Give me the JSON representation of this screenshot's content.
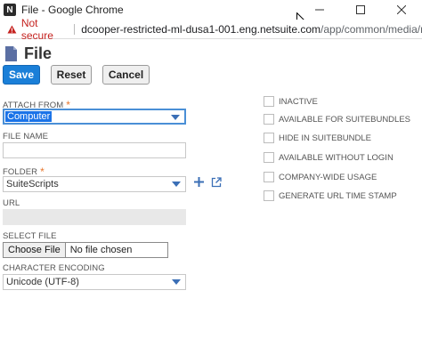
{
  "window": {
    "title": "File - Google Chrome",
    "app_icon_letter": "N"
  },
  "addressbar": {
    "security_label": "Not secure",
    "url_host": "dcooper-restricted-ml-dusa1-001.eng.netsuite.com",
    "url_path": "/app/common/media/media..."
  },
  "page": {
    "title": "File"
  },
  "toolbar": {
    "save_label": "Save",
    "reset_label": "Reset",
    "cancel_label": "Cancel"
  },
  "form": {
    "attach_from": {
      "label": "ATTACH FROM",
      "value": "Computer"
    },
    "file_name": {
      "label": "FILE NAME",
      "value": ""
    },
    "folder": {
      "label": "FOLDER",
      "value": "SuiteScripts"
    },
    "url": {
      "label": "URL",
      "value": ""
    },
    "select_file": {
      "label": "SELECT FILE",
      "button_label": "Choose File",
      "status": "No file chosen"
    },
    "character_encoding": {
      "label": "CHARACTER ENCODING",
      "value": "Unicode (UTF-8)"
    }
  },
  "options": [
    {
      "label": "INACTIVE",
      "checked": false
    },
    {
      "label": "AVAILABLE FOR SUITEBUNDLES",
      "checked": false
    },
    {
      "label": "HIDE IN SUITEBUNDLE",
      "checked": false
    },
    {
      "label": "AVAILABLE WITHOUT LOGIN",
      "checked": false
    },
    {
      "label": "COMPANY-WIDE USAGE",
      "checked": false
    },
    {
      "label": "GENERATE URL TIME STAMP",
      "checked": false
    }
  ],
  "colors": {
    "save_button": "#1a7fd8",
    "required_marker": "#e8772e",
    "not_secure": "#c5221f",
    "dropdown_caret": "#3b6fb6"
  }
}
